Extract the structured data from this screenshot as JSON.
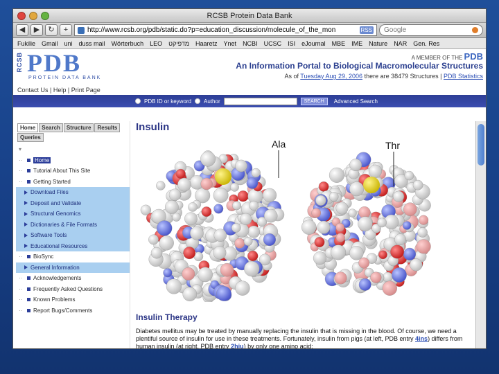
{
  "window": {
    "title": "RCSB Protein Data Bank"
  },
  "toolbar": {
    "back": "◀",
    "forward": "▶",
    "reload": "↻",
    "add": "+",
    "url": "http://www.rcsb.org/pdb/static.do?p=education_discussion/molecule_of_the_mon",
    "rss": "RSS",
    "search_placeholder": "Google"
  },
  "bookmarks": [
    "Fukilie",
    "Gmail",
    "uni",
    "duss mail",
    "Wörterbuch",
    "LEO",
    "מדפיקט",
    "Haaretz",
    "Ynet",
    "NCBI",
    "UCSC",
    "ISI",
    "eJournal",
    "MBE",
    "IME",
    "Nature",
    "NAR",
    "Gen. Res"
  ],
  "pdb": {
    "rcsb": "RCSB",
    "logo": "PDB",
    "subtitle": "PROTEIN DATA BANK",
    "member": "A MEMBER OF THE",
    "member_logo": "PDB",
    "portal": "An Information Portal to Biological Macromolecular Structures",
    "asof_prefix": "As of",
    "asof_date": "Tuesday Aug 29, 2006",
    "asof_mid": "there are 38479 Structures",
    "stats": "PDB Statistics"
  },
  "links": {
    "contact": "Contact Us",
    "help": "Help",
    "print": "Print Page"
  },
  "strip": {
    "pdb_id": "PDB ID or keyword",
    "author": "Author",
    "search_btn": "SEARCH",
    "advanced": "Advanced Search"
  },
  "tabs": [
    "Home",
    "Search",
    "Structure",
    "Results",
    "Queries"
  ],
  "nav": [
    {
      "label": "Home",
      "kind": "sel"
    },
    {
      "label": "Tutorial About This Site",
      "kind": "top"
    },
    {
      "label": "Getting Started",
      "kind": "top"
    },
    {
      "label": "Download Files",
      "kind": "sub"
    },
    {
      "label": "Deposit and Validate",
      "kind": "sub"
    },
    {
      "label": "Structural Genomics",
      "kind": "sub"
    },
    {
      "label": "Dictionaries & File Formats",
      "kind": "sub"
    },
    {
      "label": "Software Tools",
      "kind": "sub"
    },
    {
      "label": "Educational Resources",
      "kind": "sub"
    },
    {
      "label": "BioSync",
      "kind": "top"
    },
    {
      "label": "General Information",
      "kind": "sub"
    },
    {
      "label": "Acknowledgements",
      "kind": "top"
    },
    {
      "label": "Frequently Asked Questions",
      "kind": "top"
    },
    {
      "label": "Known Problems",
      "kind": "top"
    },
    {
      "label": "Report Bugs/Comments",
      "kind": "top"
    }
  ],
  "content": {
    "title": "Insulin",
    "label_left": "Ala",
    "label_right": "Thr",
    "section": "Insulin Therapy",
    "para_1": "Diabetes mellitus may be treated by manually replacing the insulin that is missing in the blood. Of course, we need a plentiful source of insulin for use in these treatments. Fortunately, insulin from pigs (at left, PDB entry",
    "entry_1": "4ins",
    "para_2": ") differs from human insulin (at right, PDB entry",
    "entry_2": "2hiu",
    "para_3": ") by only one amino acid:"
  }
}
